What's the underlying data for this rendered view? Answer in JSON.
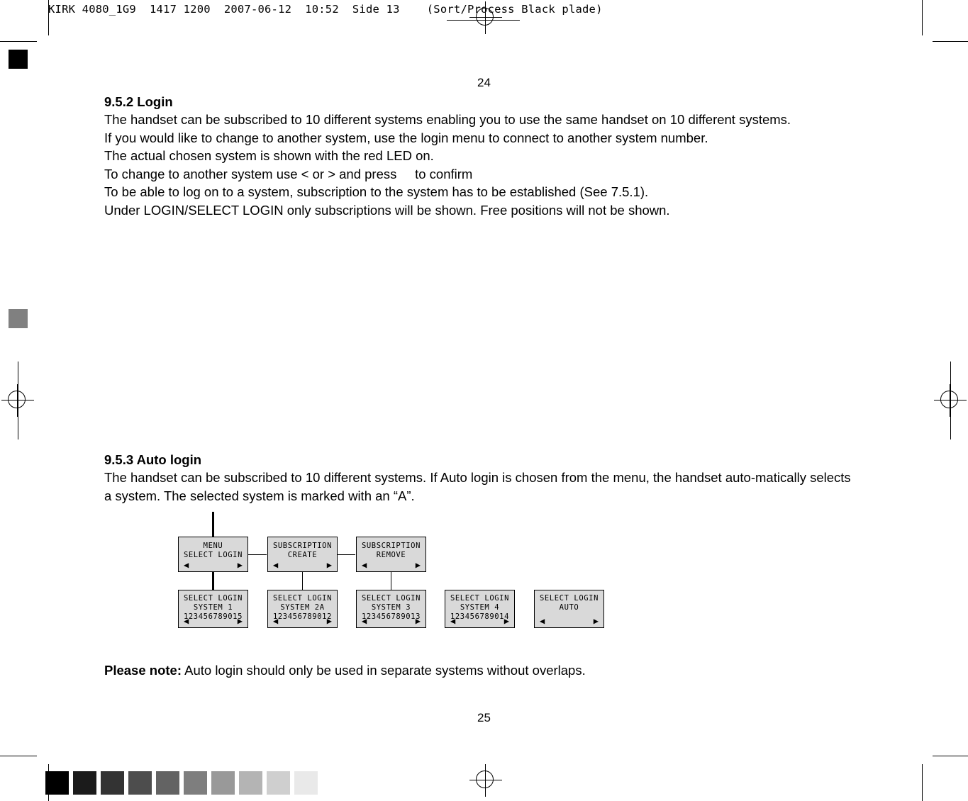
{
  "plate_header": {
    "text": "KIRK 4080_1G9  1417 1200  2007-06-12  10:52  Side 13    (Sort/Process Black plade)"
  },
  "page_numbers": {
    "top": "24",
    "bottom": "25"
  },
  "section_952": {
    "heading": "9.5.2 Login",
    "lines": [
      "The handset can be subscribed to 10 different systems enabling you to use the same handset on 10 different systems.",
      "If you would like to change to another system, use the login menu to connect to another system number.",
      "The actual chosen system is shown with the red LED on.",
      "To change to another system use < or > and press     to confirm",
      "To be able to log on to a system, subscription to the system has to be established (See 7.5.1).",
      "Under LOGIN/SELECT LOGIN only subscriptions will be shown. Free positions will not be shown."
    ]
  },
  "section_953": {
    "heading": "9.5.3 Auto login",
    "lines": [
      "The handset can be subscribed to 10 different systems. If Auto login is chosen from the menu, the handset auto-matically selects a system. The selected system is marked with an “A”."
    ]
  },
  "note": {
    "label": "Please note:",
    "text": " Auto login should only be used in separate systems without overlaps."
  },
  "diagram": {
    "arrow_left": "◀",
    "arrow_right": "▶",
    "top_row": [
      {
        "line1": "MENU",
        "line2": "SELECT LOGIN"
      },
      {
        "line1": "SUBSCRIPTION",
        "line2": "CREATE"
      },
      {
        "line1": "SUBSCRIPTION",
        "line2": "REMOVE"
      }
    ],
    "bottom_row": [
      {
        "line1": "SELECT LOGIN",
        "line2": "SYSTEM 1",
        "line3": "123456789015"
      },
      {
        "line1": "SELECT LOGIN",
        "line2": "SYSTEM 2A",
        "line3": "123456789012"
      },
      {
        "line1": "SELECT LOGIN",
        "line2": "SYSTEM 3",
        "line3": "123456789013"
      },
      {
        "line1": "SELECT LOGIN",
        "line2": "SYSTEM 4",
        "line3": "123456789014"
      },
      {
        "line1": "SELECT LOGIN",
        "line2": "AUTO",
        "line3": ""
      }
    ]
  },
  "prepress": {
    "swatches": [
      "#000000",
      "#1b1b1b",
      "#333333",
      "#4d4d4d",
      "#636363",
      "#7e7e7e",
      "#999999",
      "#b4b4b4",
      "#cfcfcf",
      "#e9e9e9"
    ],
    "reg_square_top_color": "#000000",
    "reg_square_mid_color": "#808080"
  }
}
